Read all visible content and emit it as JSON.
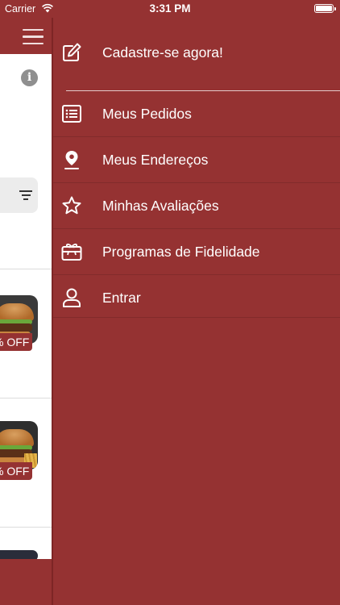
{
  "status_bar": {
    "carrier": "Carrier",
    "time": "3:31 PM"
  },
  "background": {
    "discount_label": "% OFF",
    "accent_color": "#953232"
  },
  "drawer": {
    "items": [
      {
        "label": "Cadastre-se agora!",
        "icon": "edit-icon"
      },
      {
        "label": "Meus Pedidos",
        "icon": "list-icon"
      },
      {
        "label": "Meus Endereços",
        "icon": "location-pin-icon"
      },
      {
        "label": "Minhas Avaliações",
        "icon": "star-icon"
      },
      {
        "label": "Programas de Fidelidade",
        "icon": "gift-card-icon"
      },
      {
        "label": "Entrar",
        "icon": "user-icon"
      }
    ]
  }
}
